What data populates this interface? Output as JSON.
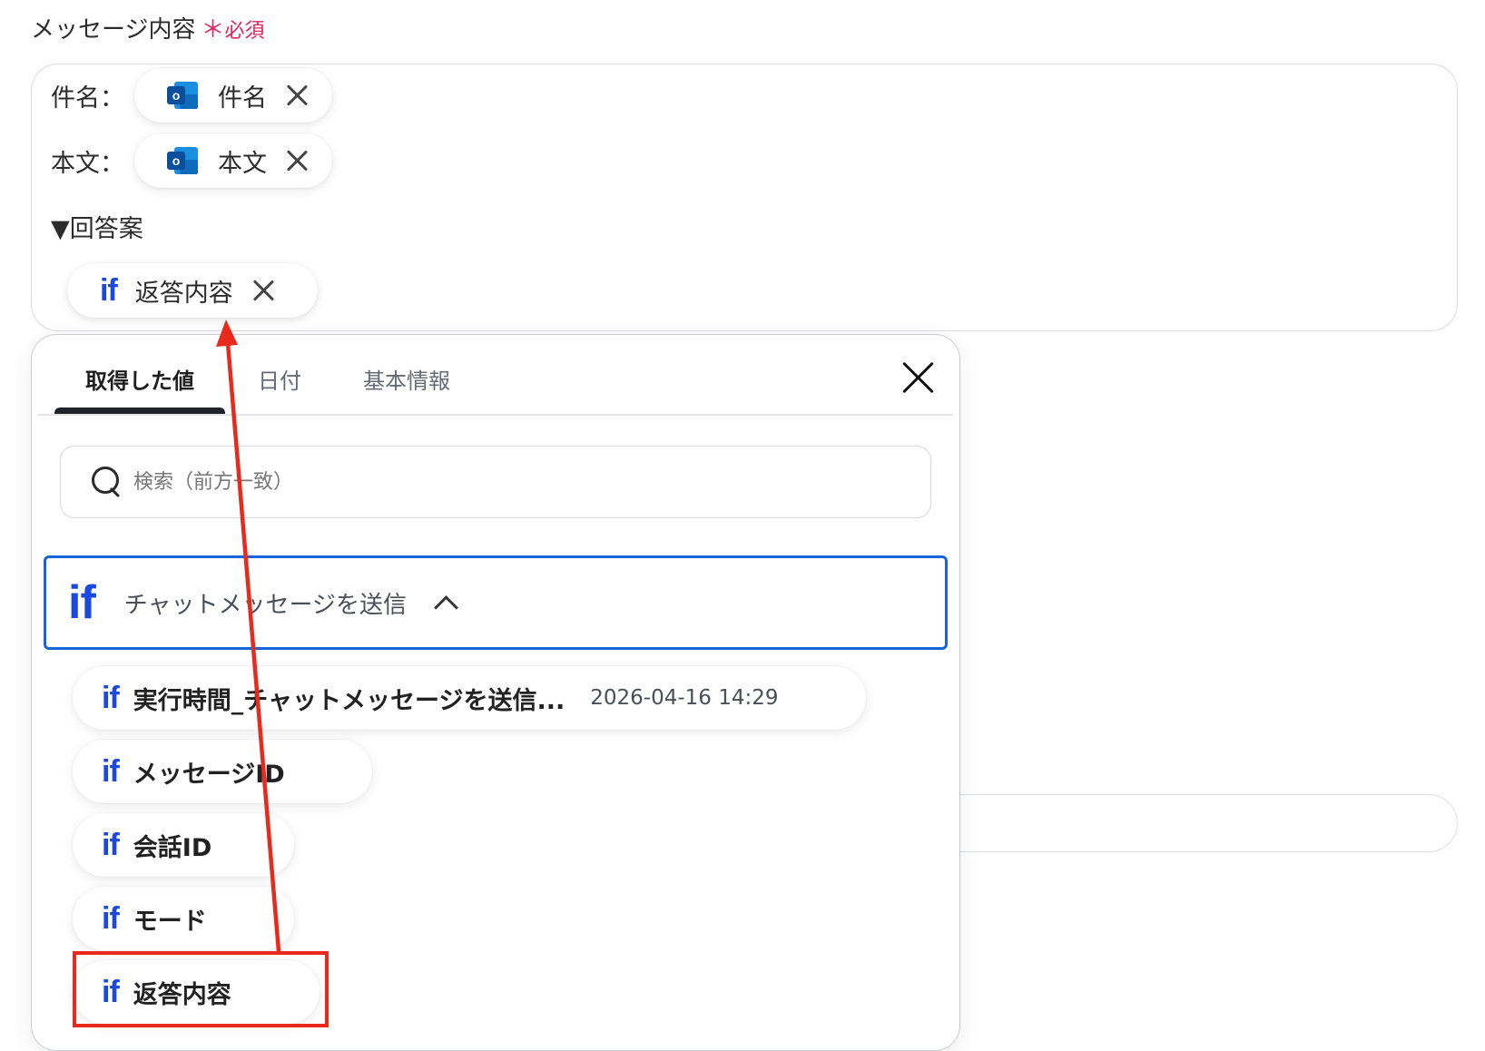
{
  "field": {
    "label": "メッセージ内容",
    "required_mark": "＊",
    "required_text": "必須"
  },
  "message": {
    "subject_label": "件名：",
    "subject_chip": "件名",
    "body_label": "本文：",
    "body_chip": "本文",
    "answer_heading": "▼回答案",
    "answer_chip": "返答内容"
  },
  "popup": {
    "tabs": [
      "取得した値",
      "日付",
      "基本情報"
    ],
    "active_tab": 0,
    "search_placeholder": "検索（前方一致）",
    "group": {
      "icon": "if",
      "title": "チャットメッセージを送信"
    },
    "items": [
      {
        "icon": "if",
        "label": "実行時間_チャットメッセージを送信...",
        "value": "2026-04-16 14:29"
      },
      {
        "icon": "if",
        "label": "メッセージID"
      },
      {
        "icon": "if",
        "label": "会話ID"
      },
      {
        "icon": "if",
        "label": "モード"
      },
      {
        "icon": "if",
        "label": "返答内容"
      }
    ]
  },
  "icons": {
    "outlook": "outlook-icon",
    "if": "if-icon",
    "close": "close-icon",
    "search": "search-icon",
    "chevron": "chevron-up-icon"
  },
  "colors": {
    "accent": "#1a63d8",
    "if_blue": "#1b49e0",
    "required": "#e0245e",
    "annotation": "#e8291c"
  }
}
